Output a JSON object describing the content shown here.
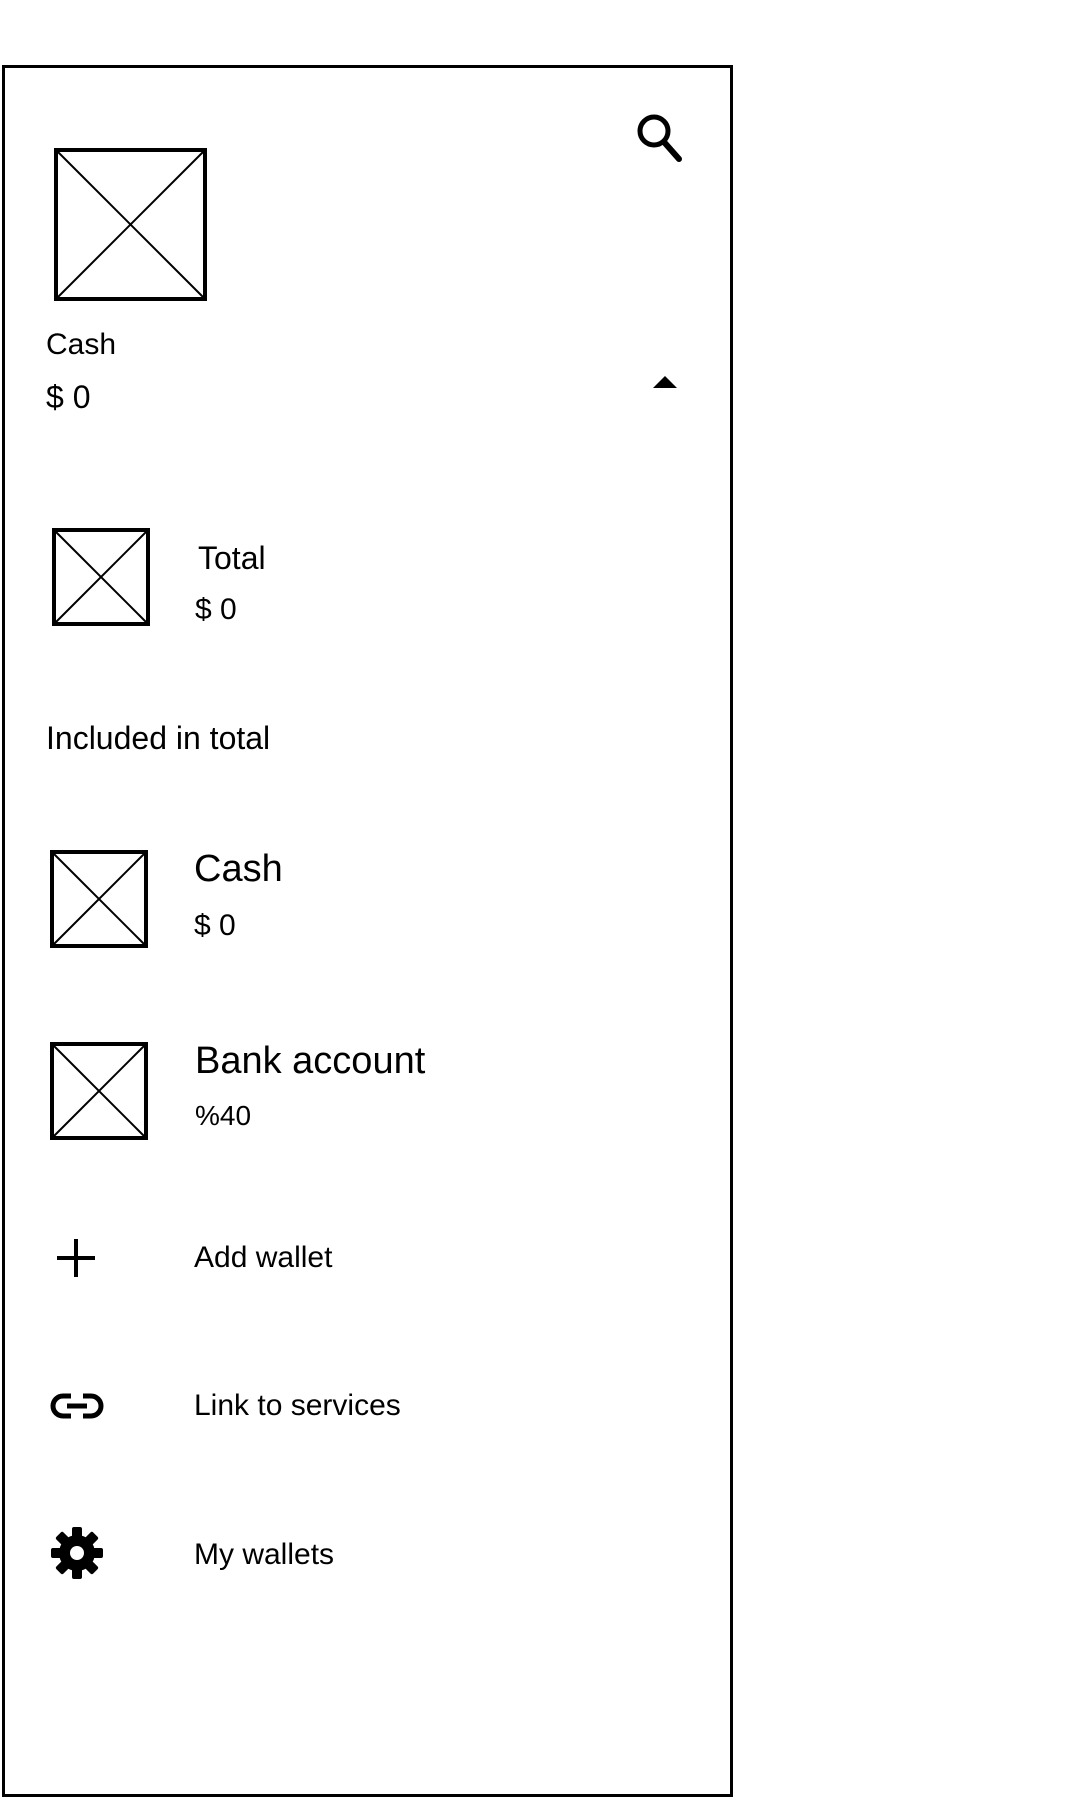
{
  "header": {
    "selected_wallet_name": "Cash",
    "selected_wallet_balance": "$ 0"
  },
  "total": {
    "label": "Total",
    "balance": "$ 0"
  },
  "section_heading": "Included in total",
  "wallets": [
    {
      "name": "Cash",
      "detail": "$ 0"
    },
    {
      "name": "Bank account",
      "detail": "%40"
    }
  ],
  "actions": [
    {
      "label": "Add wallet",
      "icon": "plus-icon"
    },
    {
      "label": "Link to services",
      "icon": "link-icon"
    },
    {
      "label": "My wallets",
      "icon": "gear-icon"
    }
  ],
  "icons": {
    "search": "search-icon",
    "collapse": "caret-up-icon"
  }
}
